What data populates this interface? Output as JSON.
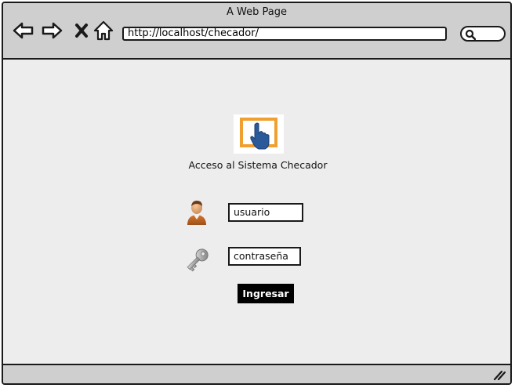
{
  "browser": {
    "title": "A Web Page",
    "url": "http://localhost/checador/",
    "nav_icons": [
      "back-arrow-icon",
      "forward-arrow-icon",
      "close-x-icon",
      "home-icon"
    ],
    "search_icon": "search-icon"
  },
  "login": {
    "heading": "Acceso al Sistema Checador",
    "username_value": "usuario",
    "password_value": "contraseña",
    "submit_label": "Ingresar"
  },
  "colors": {
    "chrome": "#cfcfcf",
    "page_background": "#ededed",
    "logo_frame": "#f0a030",
    "logo_hand": "#2a5a9a",
    "button": "#000000"
  }
}
